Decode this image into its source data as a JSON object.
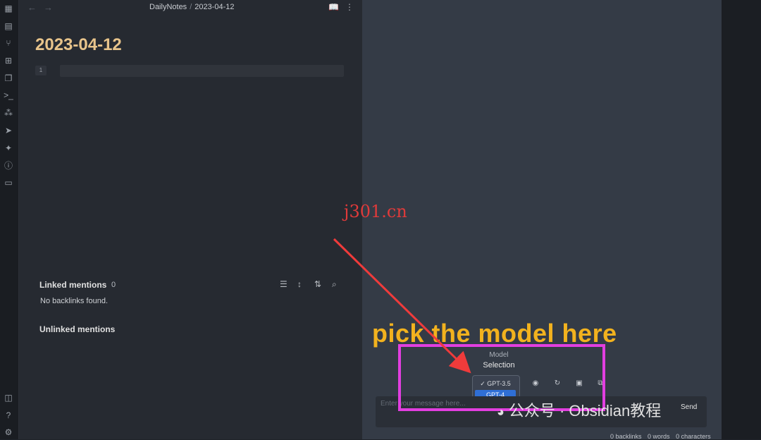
{
  "header": {
    "breadcrumb_folder": "DailyNotes",
    "breadcrumb_separator": "/",
    "breadcrumb_file": "2023-04-12"
  },
  "note": {
    "title": "2023-04-12",
    "line_number": "1"
  },
  "mentions": {
    "linked_label": "Linked mentions",
    "linked_count": "0",
    "no_backlinks": "No backlinks found.",
    "unlinked_label": "Unlinked mentions"
  },
  "chat": {
    "model_label_line1": "Model",
    "model_label_line2": "Selection",
    "models": [
      {
        "label": "✓ GPT-3.5",
        "selected": false
      },
      {
        "label": "GPT-4",
        "selected": true
      }
    ],
    "input_placeholder": "Enter your message here...",
    "send_label": "Send"
  },
  "status": {
    "backlinks": "0 backlinks",
    "words": "0 words",
    "characters": "0 characters"
  },
  "annotation": {
    "callout": "pick the model here",
    "watermark": "j301.cn",
    "wechat": "公众号 · Obsidian教程"
  },
  "colors": {
    "title_gold": "#e8c48b",
    "annotation_magenta": "#e23ee0",
    "annotation_orange": "#f2b21e",
    "arrow_red": "#ef3b3b",
    "selected_blue": "#2f6fd6"
  }
}
